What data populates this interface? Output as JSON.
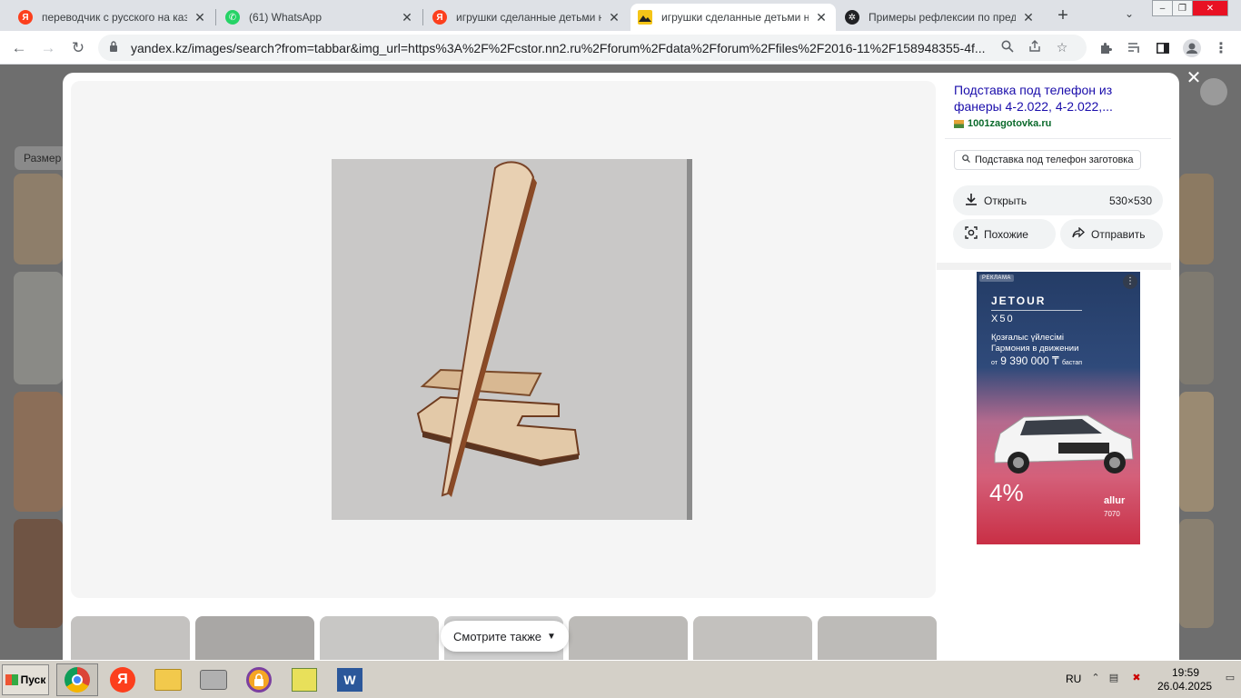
{
  "browser": {
    "tabs": [
      {
        "title": "переводчик с русского на казахский",
        "favicon": "yandex-icon",
        "active": false
      },
      {
        "title": "(61) WhatsApp",
        "favicon": "whatsapp-icon",
        "active": false
      },
      {
        "title": "игрушки сделанные детьми на уроках",
        "favicon": "yandex-icon",
        "active": false
      },
      {
        "title": "игрушки сделанные детьми на уроках",
        "favicon": "image-icon",
        "active": true
      },
      {
        "title": "Примеры рефлексии по предметам",
        "favicon": "chatgpt-icon",
        "active": false
      }
    ],
    "url": "yandex.kz/images/search?from=tabbar&img_url=https%3A%2F%2Fcstor.nn2.ru%2Fforum%2Fdata%2Fforum%2Ffiles%2F2016-11%2F158948355-4f..."
  },
  "page": {
    "filter_label": "Размер"
  },
  "viewer": {
    "see_also_label": "Смотрите также"
  },
  "info": {
    "title": "Подставка под телефон из фанеры 4-2.022, 4-2.022,...",
    "source": "1001zagotovka.ru",
    "tag": "Подставка под телефон заготовка",
    "open_label": "Открыть",
    "dimensions": "530×530",
    "similar_label": "Похожие",
    "share_label": "Отправить"
  },
  "ad": {
    "label": "РЕКЛАМА",
    "brand": "JETOUR",
    "model": "X50",
    "line1": "Қозғалыс үйлесімі",
    "line2": "Гармония в движении",
    "price_prefix": "от",
    "price": "9 390 000 ₸",
    "price_suffix": "бастап",
    "rate": "4%",
    "dealer": "allur",
    "phone": "7070"
  },
  "taskbar": {
    "start_label": "Пуск",
    "lang": "RU",
    "time": "19:59",
    "date": "26.04.2025"
  },
  "colors": {
    "link": "#1a0dab",
    "source_green": "#0b6a2c",
    "yandex_red": "#fc3f1d",
    "whatsapp_green": "#25d366"
  }
}
